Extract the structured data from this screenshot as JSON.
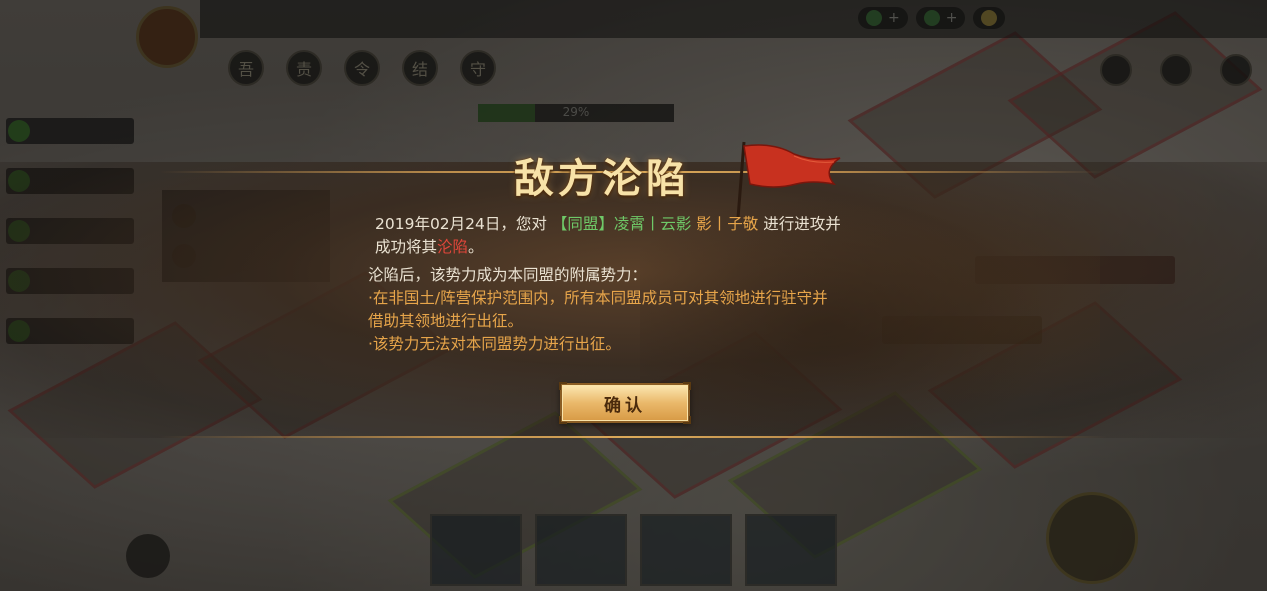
{
  "modal": {
    "title": "敌方沦陷",
    "line1": {
      "prefix": "2019年02月24日，您对",
      "alliance_tag": "【同盟】凌霄丨云影",
      "target": "影丨子敬",
      "suffix": "进行进攻并"
    },
    "line2": {
      "prefix": "成功将其",
      "highlight": "沦陷",
      "suffix": "。"
    },
    "line3": "沦陷后，该势力成为本同盟的附属势力：",
    "line4": "·在非国土/阵营保护范围内，所有本同盟成员可对其领地进行驻守并",
    "line5": "借助其领地进行出征。",
    "line6": "·该势力无法对本同盟势力进行出征。",
    "confirm_label": "确认"
  },
  "background": {
    "tab_icons": [
      "吾",
      "责",
      "令",
      "结",
      "守"
    ],
    "progress_label": "29%",
    "progress_value": 0.29
  },
  "colors": {
    "title": "#f7e2a8",
    "body_text": "#eae2d2",
    "alliance_green": "#6fc968",
    "target_orange": "#e7a54a",
    "fall_red": "#e0463a",
    "button_gold": "#eab86a"
  },
  "icons": {
    "flag": "red-war-banner-icon",
    "search": "search-icon",
    "play": "play-icon",
    "map-pin": "map-pin-icon",
    "chat": "chat-icon"
  }
}
